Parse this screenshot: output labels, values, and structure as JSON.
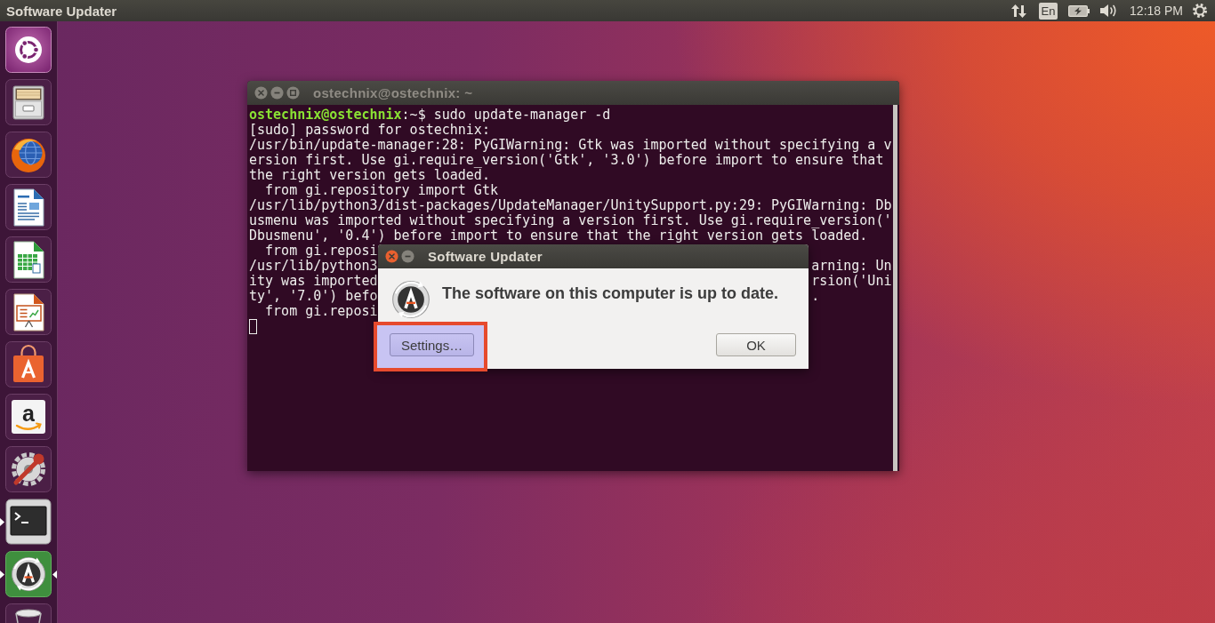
{
  "top_panel": {
    "title": "Software Updater",
    "keyboard_layout": "En",
    "clock": "12:18 PM"
  },
  "launcher": {
    "items": [
      {
        "kind": "dash",
        "running": false,
        "focused": false
      },
      {
        "kind": "files",
        "running": false,
        "focused": false
      },
      {
        "kind": "browser",
        "running": false,
        "focused": false
      },
      {
        "kind": "writer",
        "running": false,
        "focused": false
      },
      {
        "kind": "calc",
        "running": false,
        "focused": false
      },
      {
        "kind": "impress",
        "running": false,
        "focused": false
      },
      {
        "kind": "store",
        "running": false,
        "focused": false
      },
      {
        "kind": "shop",
        "running": false,
        "focused": false,
        "glyph": "a"
      },
      {
        "kind": "settings",
        "running": false,
        "focused": false
      },
      {
        "kind": "terminal",
        "running": true,
        "focused": false
      },
      {
        "kind": "updater",
        "running": true,
        "focused": true
      },
      {
        "kind": "trash",
        "running": false,
        "focused": false
      }
    ]
  },
  "terminal": {
    "title": "ostechnix@ostechnix: ~",
    "focused": false,
    "maximizable": true,
    "lines": [
      {
        "kind": "prompt",
        "user": "ostechnix@ostechnix",
        "text": ":~$ sudo update-manager -d"
      },
      {
        "kind": "output",
        "text": "[sudo] password for ostechnix:"
      },
      {
        "kind": "output",
        "text": "/usr/bin/update-manager:28: PyGIWarning: Gtk was imported without specifying a v"
      },
      {
        "kind": "output",
        "text": "ersion first. Use gi.require_version('Gtk', '3.0') before import to ensure that"
      },
      {
        "kind": "output",
        "text": "the right version gets loaded."
      },
      {
        "kind": "output",
        "text": "  from gi.repository import Gtk"
      },
      {
        "kind": "output",
        "text": "/usr/lib/python3/dist-packages/UpdateManager/UnitySupport.py:29: PyGIWarning: Db"
      },
      {
        "kind": "output",
        "text": "usmenu was imported without specifying a version first. Use gi.require_version('"
      },
      {
        "kind": "output",
        "text": "Dbusmenu', '0.4') before import to ensure that the right version gets loaded."
      },
      {
        "kind": "output",
        "text": "  from gi.reposi"
      },
      {
        "kind": "output",
        "text": "/usr/lib/python3",
        "tail": "arning: Un"
      },
      {
        "kind": "output",
        "text": "ity was imported",
        "tail": "rsion('Uni"
      },
      {
        "kind": "output",
        "text": "ty', '7.0') befo",
        "tail": "."
      },
      {
        "kind": "output",
        "text": "  from gi.reposi"
      }
    ]
  },
  "dialog": {
    "title": "Software Updater",
    "focused": true,
    "maximizable": false,
    "message": "The software on this computer is up to date.",
    "buttons": [
      {
        "label": "Settings…",
        "highlighted": true
      },
      {
        "label": "OK",
        "highlighted": false
      }
    ]
  }
}
